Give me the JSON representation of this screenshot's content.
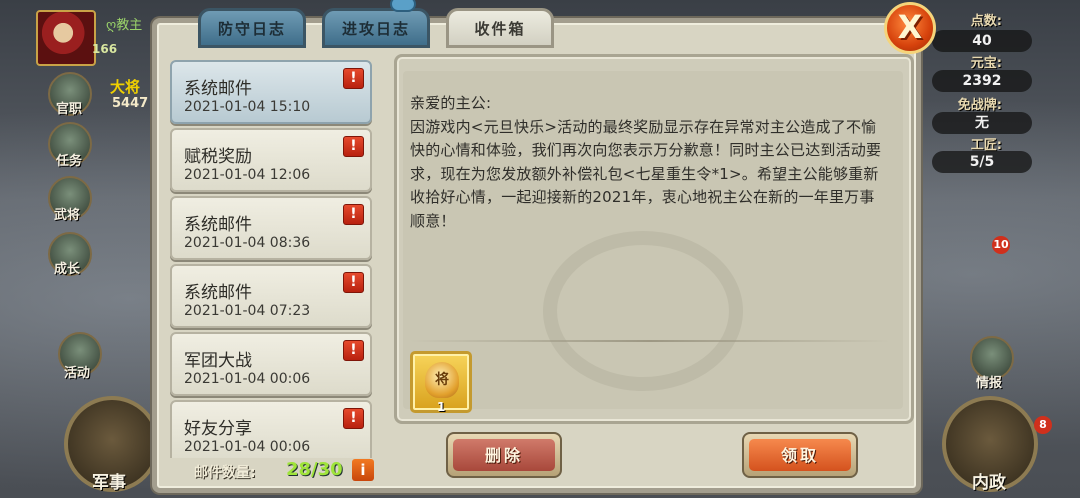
{
  "hud": {
    "player_name": "ღ教主",
    "level": "166",
    "rank_label": "大将",
    "gold_amount": "5447",
    "left_buttons": [
      "官职",
      "任务",
      "武将",
      "成长",
      "活动"
    ],
    "military_label": "军事",
    "right_stats": [
      {
        "label": "点数:",
        "value": "40"
      },
      {
        "label": "元宝:",
        "value": "2392"
      },
      {
        "label": "免战牌:",
        "value": "无"
      },
      {
        "label": "工匠:",
        "value": "5/5"
      }
    ],
    "intel_label": "情报",
    "interior_label": "内政",
    "badge_right": "10",
    "badge_interior": "8"
  },
  "tabs": [
    {
      "label": "防守日志",
      "active": false
    },
    {
      "label": "进攻日志",
      "active": false
    },
    {
      "label": "收件箱",
      "active": true
    }
  ],
  "close_label": "X",
  "mails": [
    {
      "title": "系统邮件",
      "date": "2021-01-04 15:10",
      "flag": "!"
    },
    {
      "title": "赋税奖励",
      "date": "2021-01-04 12:06",
      "flag": "!"
    },
    {
      "title": "系统邮件",
      "date": "2021-01-04 08:36",
      "flag": "!"
    },
    {
      "title": "系统邮件",
      "date": "2021-01-04 07:23",
      "flag": "!"
    },
    {
      "title": "军团大战",
      "date": "2021-01-04 00:06",
      "flag": "!"
    },
    {
      "title": "好友分享",
      "date": "2021-01-04 00:06",
      "flag": "!"
    }
  ],
  "mail_count": {
    "label": "邮件数量:",
    "value": "28/30",
    "info": "i"
  },
  "message": {
    "greeting": "亲爱的主公:",
    "body": "因游戏内<元旦快乐>活动的最终奖励显示存在异常对主公造成了不愉快的心情和体验，我们再次向您表示万分歉意！同时主公已达到活动要求，现在为您发放额外补偿礼包<七星重生令*1>。希望主公能够重新收拾好心情，一起迎接新的2021年，衷心地祝主公在新的一年里万事顺意！"
  },
  "reward": {
    "icon": "token-icon",
    "glyph": "将",
    "quantity": "1"
  },
  "buttons": {
    "delete": "删除",
    "claim": "领取"
  }
}
